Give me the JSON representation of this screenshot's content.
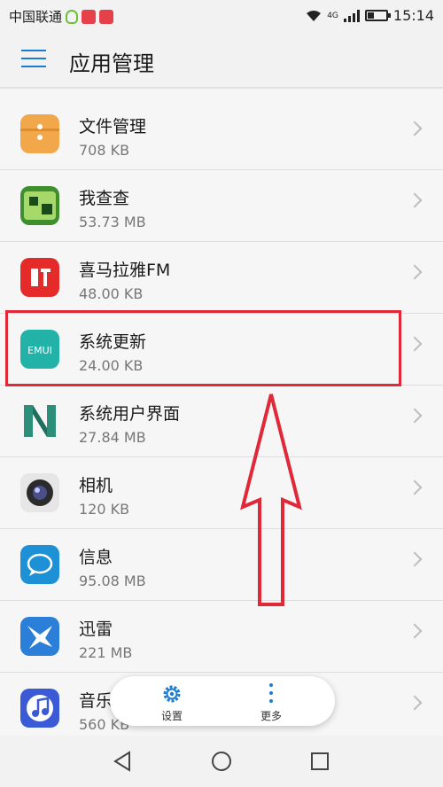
{
  "status_bar": {
    "carrier": "中国联通",
    "network": "4G",
    "time": "15:14"
  },
  "header": {
    "title": "应用管理",
    "menu_icon": "hamburger-menu-icon"
  },
  "apps": [
    {
      "name": "文件管理",
      "size": "708 KB",
      "icon": "file-manager-icon",
      "color": "#f2a84a"
    },
    {
      "name": "我查查",
      "size": "53.73 MB",
      "icon": "wochacha-icon",
      "color": "#3f8f2f"
    },
    {
      "name": "喜马拉雅FM",
      "size": "48.00 KB",
      "icon": "ximalaya-icon",
      "color": "#e52a2a"
    },
    {
      "name": "系统更新",
      "size": "24.00 KB",
      "icon": "emui-update-icon",
      "color": "#22b2a8"
    },
    {
      "name": "系统用户界面",
      "size": "27.84 MB",
      "icon": "system-ui-icon",
      "color": "#2d8f7a"
    },
    {
      "name": "相机",
      "size": "120 KB",
      "icon": "camera-icon",
      "color": "#d9d9d9"
    },
    {
      "name": "信息",
      "size": "95.08 MB",
      "icon": "messages-icon",
      "color": "#1e90d6"
    },
    {
      "name": "迅雷",
      "size": "221 MB",
      "icon": "xunlei-icon",
      "color": "#2b7fd8"
    },
    {
      "name": "音乐",
      "size": "560 KB",
      "icon": "music-icon",
      "color": "#3b5bd6"
    }
  ],
  "toolbar": {
    "settings_label": "设置",
    "more_label": "更多"
  },
  "highlight_color": "#e02838",
  "accent_color": "#1e7bd2"
}
